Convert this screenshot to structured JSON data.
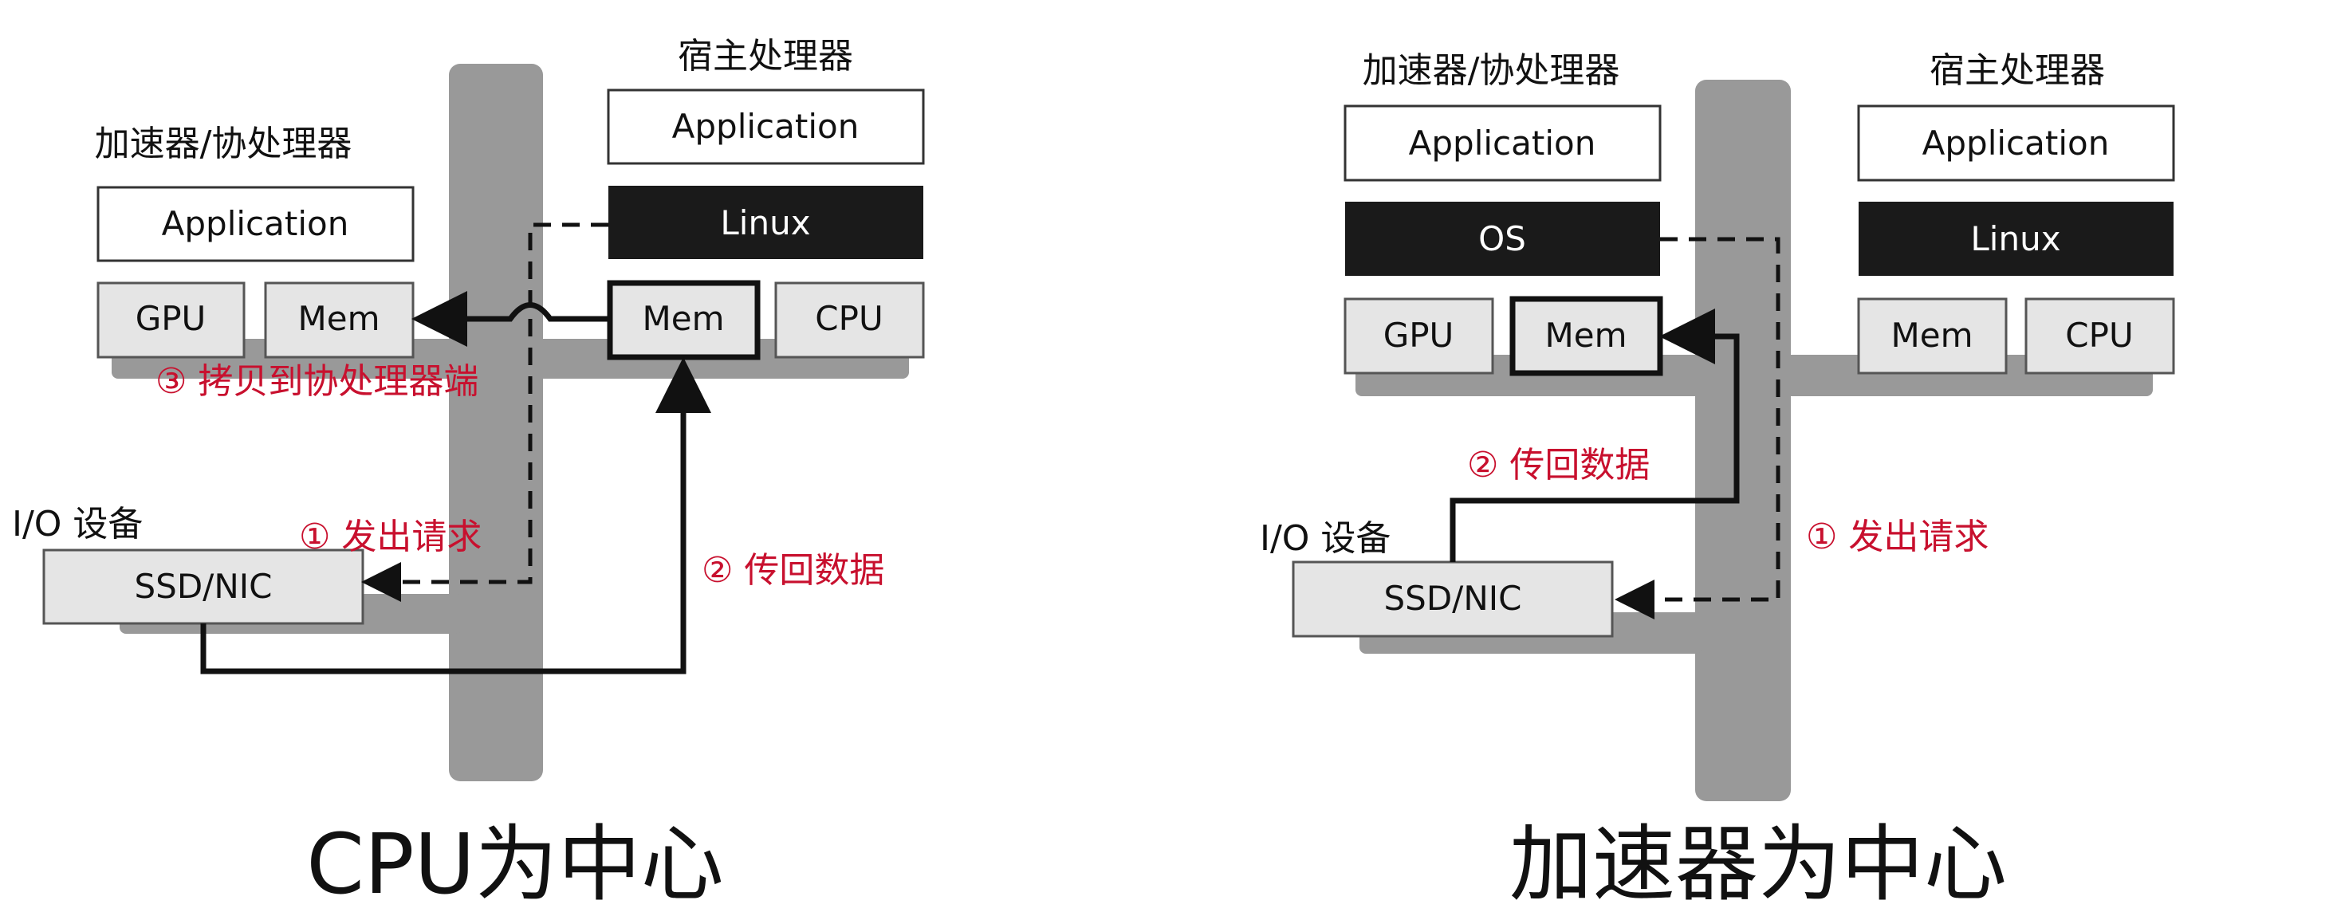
{
  "colors": {
    "bus": "#999999",
    "box_light": "#e5e5e5",
    "box_white": "#ffffff",
    "box_dark": "#1a1a1a",
    "line": "#111111",
    "red": "#c8102e"
  },
  "left": {
    "host_title": "宿主处理器",
    "host_app": "Application",
    "host_os": "Linux",
    "host_mem": "Mem",
    "host_cpu": "CPU",
    "acc_title": "加速器/协处理器",
    "acc_app": "Application",
    "acc_gpu": "GPU",
    "acc_mem": "Mem",
    "io_title": "I/O 设备",
    "io_device": "SSD/NIC",
    "step1": "① 发出请求",
    "step2": "② 传回数据",
    "step3": "③ 拷贝到协处理器端",
    "caption": "CPU为中心"
  },
  "right": {
    "acc_title": "加速器/协处理器",
    "acc_app": "Application",
    "acc_os": "OS",
    "acc_gpu": "GPU",
    "acc_mem": "Mem",
    "host_title": "宿主处理器",
    "host_app": "Application",
    "host_os": "Linux",
    "host_mem": "Mem",
    "host_cpu": "CPU",
    "io_title": "I/O 设备",
    "io_device": "SSD/NIC",
    "step1": "① 发出请求",
    "step2": "② 传回数据",
    "caption": "加速器为中心"
  }
}
